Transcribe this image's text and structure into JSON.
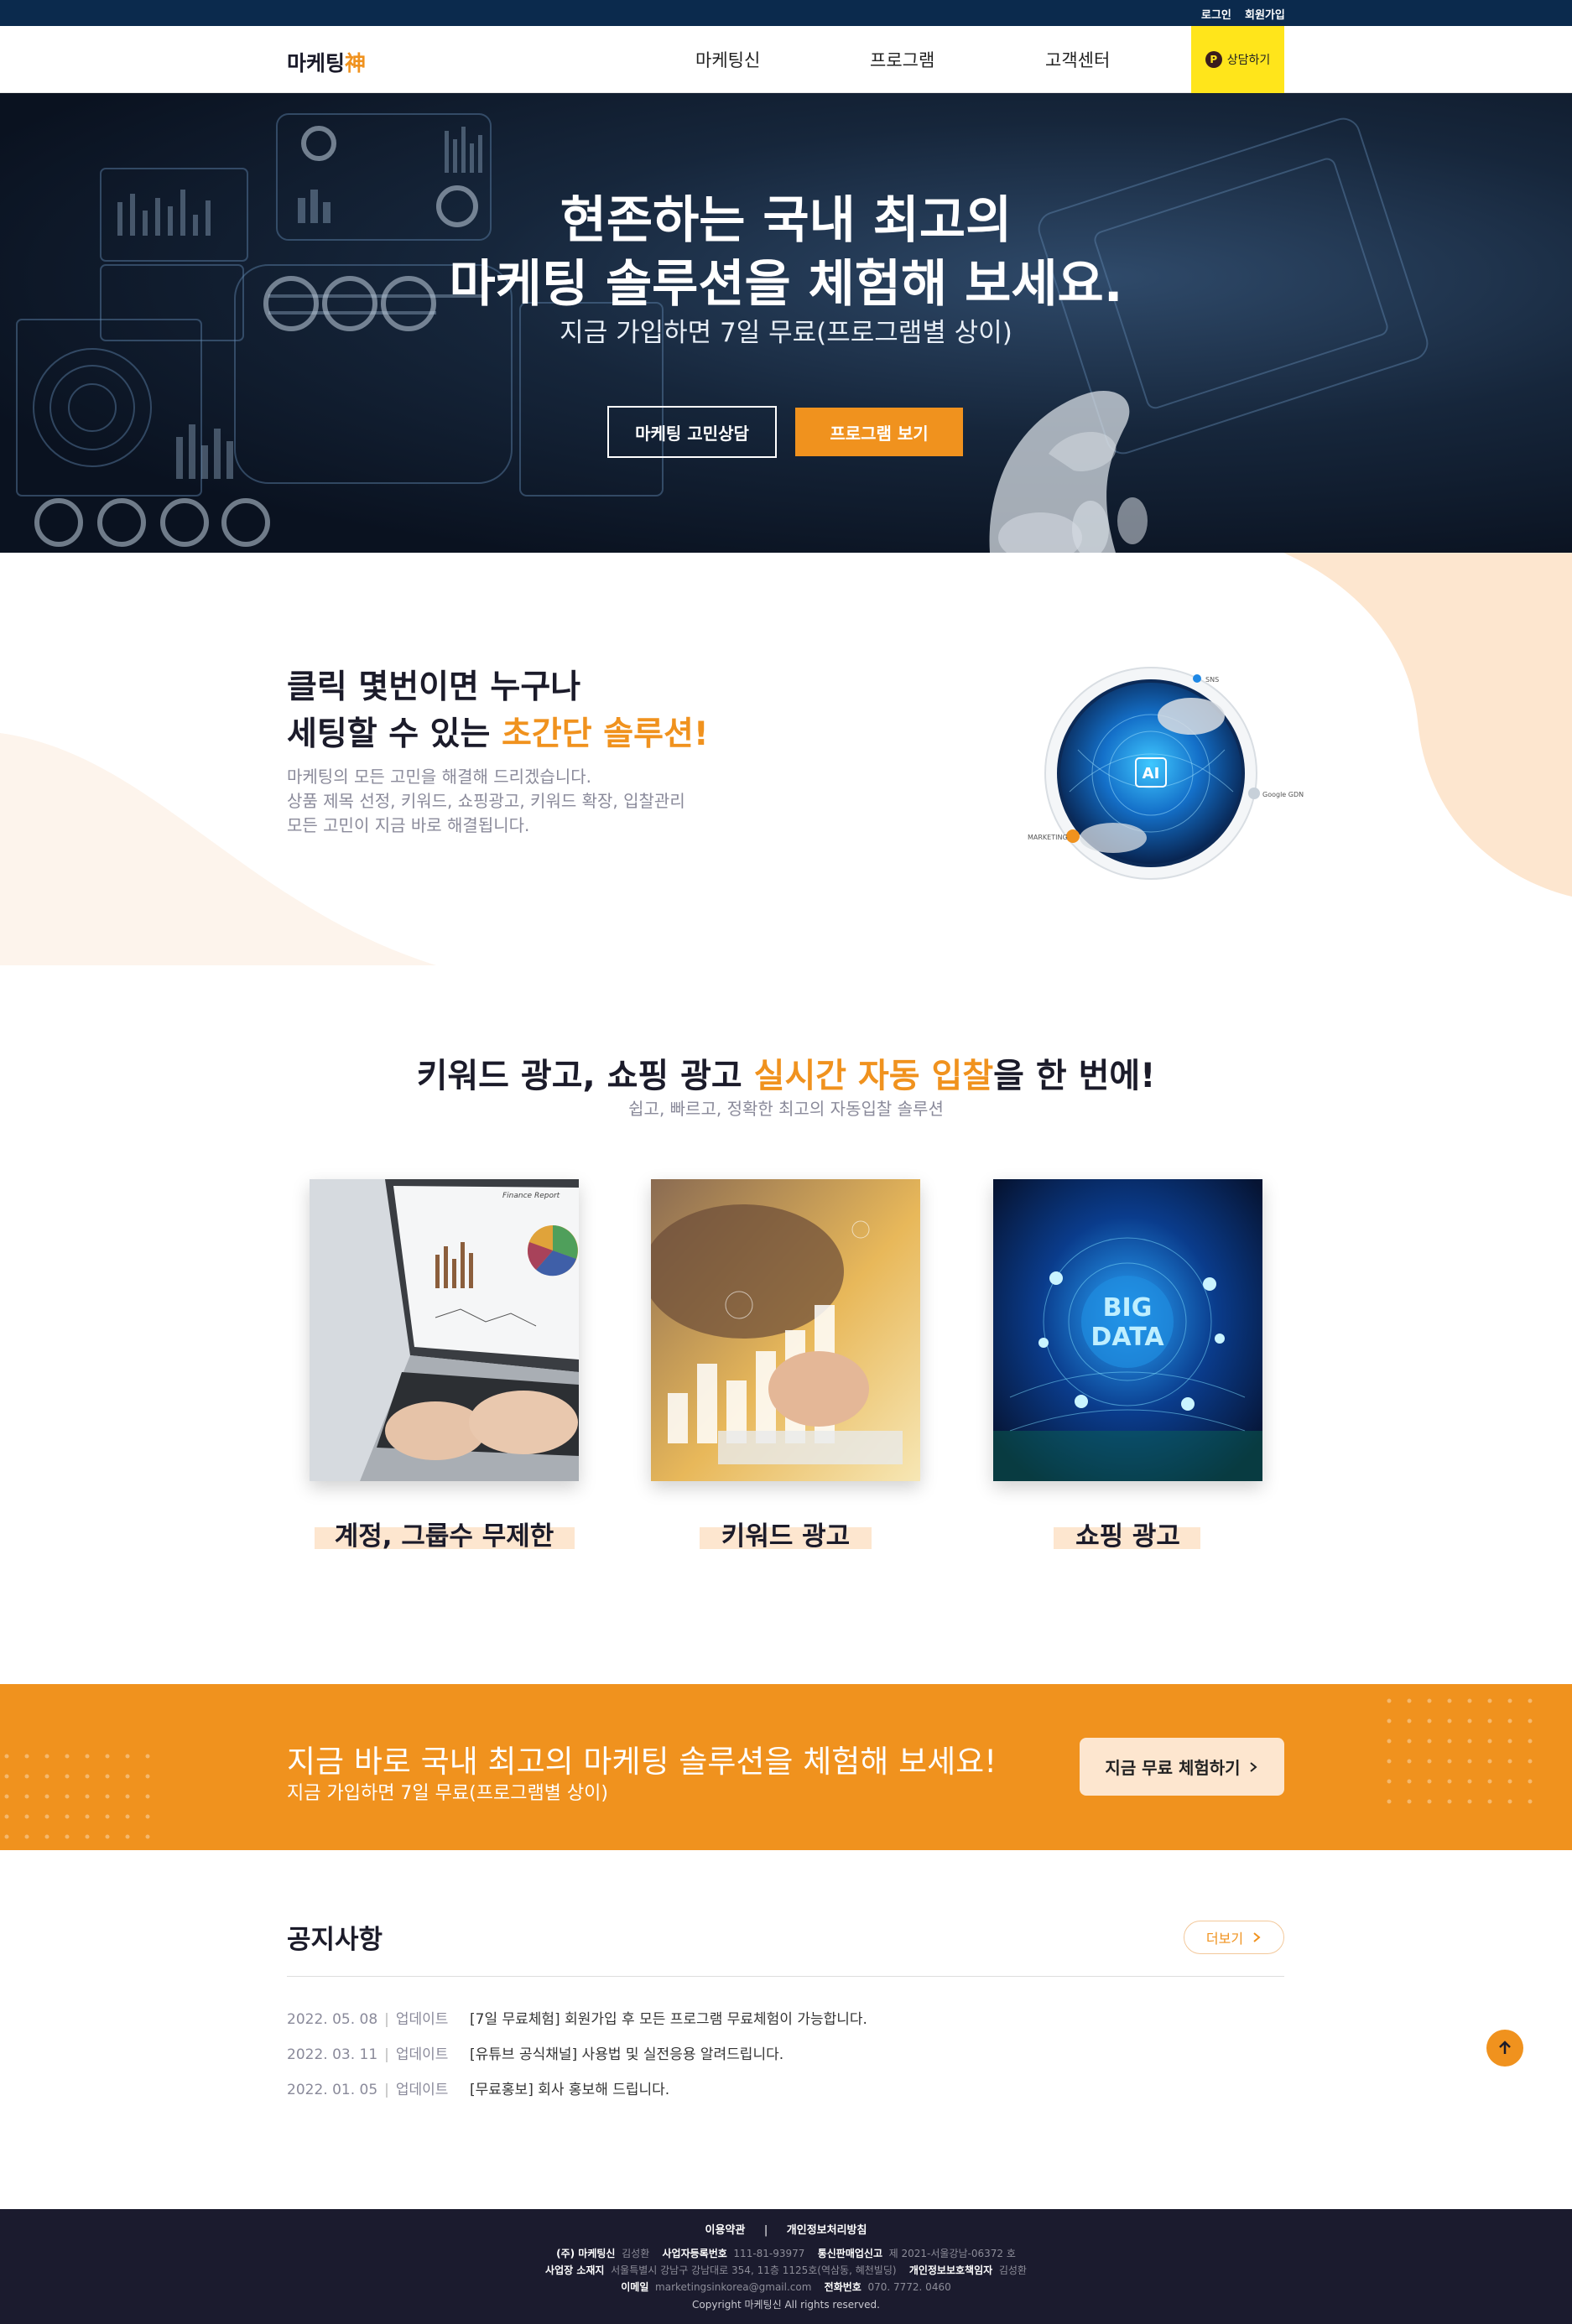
{
  "topbar": {
    "login": "로그인",
    "signup": "회원가입"
  },
  "header": {
    "logo_text": "마케팅",
    "logo_accent": "神",
    "nav": [
      "마케팅신",
      "프로그램",
      "고객센터"
    ],
    "consult_icon": "P",
    "consult_label": "상담하기"
  },
  "hero": {
    "title_line1": "현존하는 국내 최고의",
    "title_line2": "마케팅 솔루션을 체험해 보세요.",
    "subtitle": "지금 가입하면 7일 무료(프로그램별 상이)",
    "btn_consult": "마케팅 고민상담",
    "btn_program": "프로그램 보기"
  },
  "intro": {
    "title_line1": "클릭 몇번이면 누구나",
    "title_line2_prefix": "세팅할 수 있는 ",
    "title_line2_highlight": "초간단 솔루션!",
    "desc": [
      "마케팅의 모든 고민을 해결해 드리겠습니다.",
      "상품 제목 선정, 키워드, 쇼핑광고, 키워드 확장, 입찰관리",
      "모든 고민이 지금 바로 해결됩니다."
    ],
    "orbit_labels": {
      "sns": "SNS",
      "google": "Google GDN",
      "marketing": "MARKETING"
    },
    "badge": "AI"
  },
  "features": {
    "title_prefix": "키워드 광고, 쇼핑 광고 ",
    "title_highlight": "실시간 자동 입찰",
    "title_suffix": "을 한 번에!",
    "subtitle": "쉽고, 빠르고, 정확한 최고의 자동입찰 솔루션",
    "cards": [
      {
        "label": "계정, 그룹수 무제한",
        "report_title": "Finance Report"
      },
      {
        "label": "키워드 광고"
      },
      {
        "label": "쇼핑 광고",
        "art_text1": "BIG",
        "art_text2": "DATA"
      }
    ]
  },
  "cta": {
    "title": "지금 바로 국내 최고의 마케팅 솔루션을 체험해 보세요!",
    "subtitle": "지금 가입하면 7일 무료(프로그램별 상이)",
    "button": "지금 무료 체험하기",
    "button_icon": "chevron-right-icon"
  },
  "notice": {
    "title": "공지사항",
    "more": "더보기",
    "rows": [
      {
        "date": "2022. 05. 08",
        "tag": "업데이트",
        "text": "[7일 무료체험] 회원가입 후 모든 프로그램 무료체험이 가능합니다."
      },
      {
        "date": "2022. 03. 11",
        "tag": "업데이트",
        "text": "[유튜브 공식채널] 사용법 및 실전응용 알려드립니다."
      },
      {
        "date": "2022. 01. 05",
        "tag": "업데이트",
        "text": "[무료홍보] 회사 홍보해 드립니다."
      }
    ]
  },
  "footer": {
    "link_terms": "이용약관",
    "link_privacy": "개인정보처리방침",
    "company": "(주) 마케팅신",
    "ceo": "김성환",
    "biz_no_label": "사업자등록번호",
    "biz_no": "111-81-93977",
    "mail_order_label": "통신판매업신고",
    "mail_order": "제 2021-서울강남-06372 호",
    "address_label": "사업장 소재지",
    "address": "서울특별시 강남구 강남대로 354, 11층 1125호(역삼동, 혜천빌딩)",
    "privacy_officer_label": "개인정보보호책임자",
    "privacy_officer": "김성환",
    "email_label": "이메일",
    "email": "marketingsinkorea@gmail.com",
    "phone_label": "전화번호",
    "phone": "070. 7772. 0460",
    "copyright": "Copyright 마케팅신 All rights reserved."
  },
  "colors": {
    "accent": "#f0921e",
    "navy": "#0b2a4d",
    "dark": "#1b1b2e",
    "peach": "#fde6cf",
    "kakao": "#ffe51b"
  }
}
